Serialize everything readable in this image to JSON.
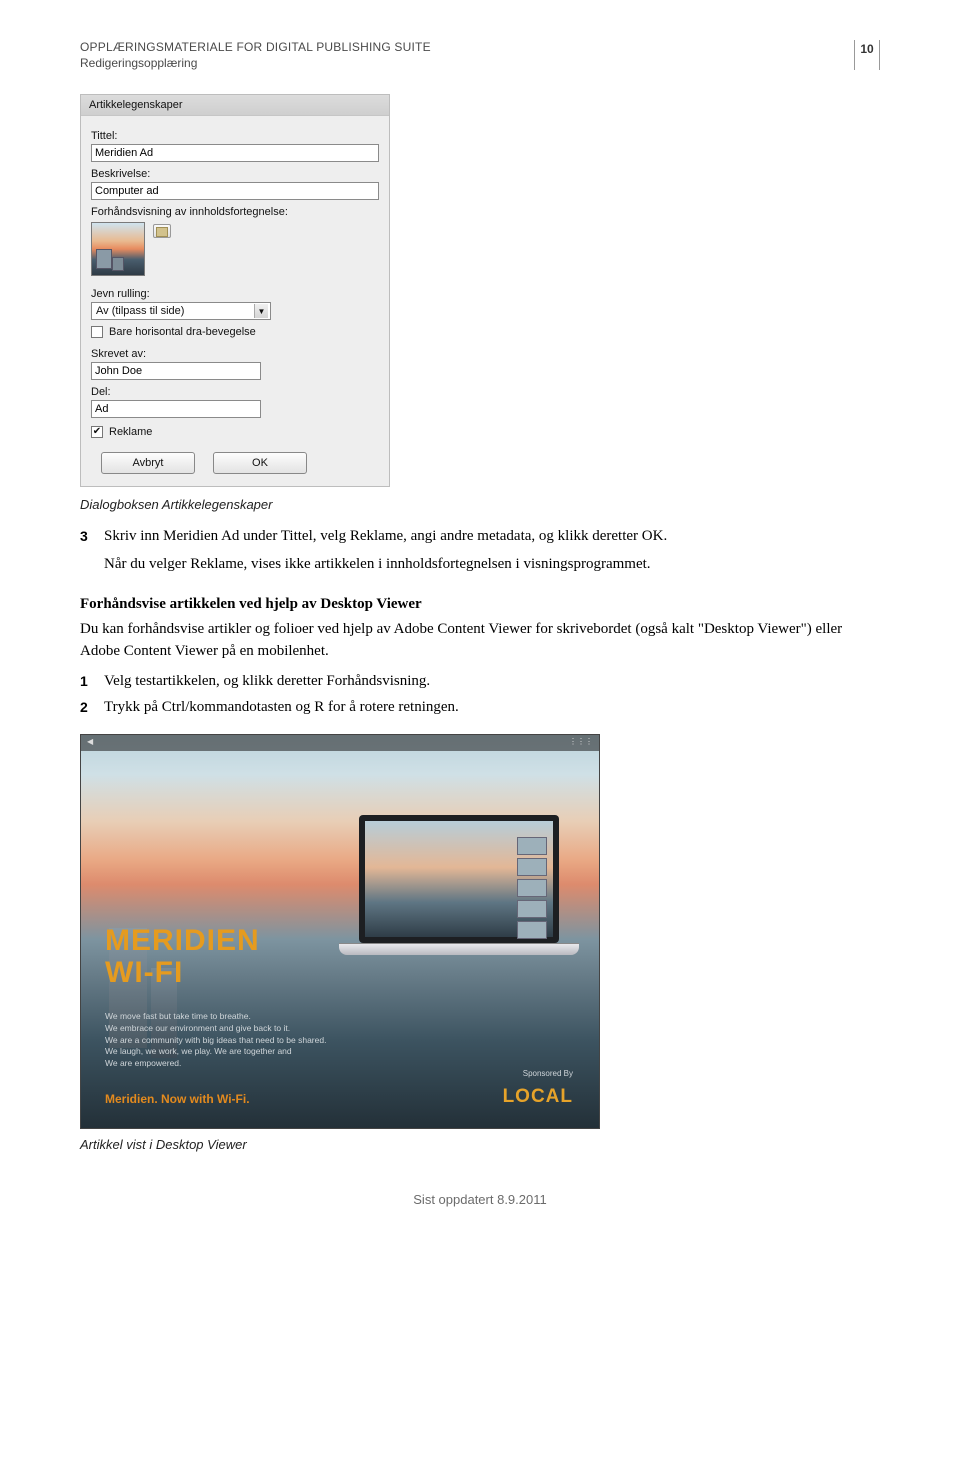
{
  "header": {
    "line1": "OPPLÆRINGSMATERIALE FOR DIGITAL PUBLISHING SUITE",
    "line2": "Redigeringsopplæring",
    "page_number": "10"
  },
  "dialog": {
    "title": "Artikkelegenskaper",
    "title_label": "Tittel:",
    "title_value": "Meridien Ad",
    "desc_label": "Beskrivelse:",
    "desc_value": "Computer ad",
    "preview_label": "Forhåndsvisning av innholdsfortegnelse:",
    "scroll_label": "Jevn rulling:",
    "scroll_value": "Av (tilpass til side)",
    "horiz_only_label": "Bare horisontal dra-bevegelse",
    "author_label": "Skrevet av:",
    "author_value": "John Doe",
    "section_label": "Del:",
    "section_value": "Ad",
    "ad_checkbox_label": "Reklame",
    "cancel_label": "Avbryt",
    "ok_label": "OK"
  },
  "caption1": "Dialogboksen Artikkelegenskaper",
  "step3_num": "3",
  "step3_text": "Skriv inn Meridien Ad under Tittel, velg Reklame, angi andre metadata, og klikk deretter OK.",
  "step3_followup": "Når du velger Reklame, vises ikke artikkelen i innholdsfortegnelsen i visningsprogrammet.",
  "section_heading": "Forhåndsvise artikkelen ved hjelp av Desktop Viewer",
  "section_body": "Du kan forhåndsvise artikler og folioer ved hjelp av Adobe Content Viewer for skrivebordet (også kalt \"Desktop Viewer\") eller Adobe Content Viewer på en mobilenhet.",
  "step1_num": "1",
  "step1_text": "Velg testartikkelen, og klikk deretter Forhåndsvisning.",
  "step2_num": "2",
  "step2_text": "Trykk på Ctrl/kommandotasten og R for å rotere retningen.",
  "ad": {
    "headline1": "MERIDIEN",
    "headline2": "WI-FI",
    "tag1": "We move fast but take time to breathe.",
    "tag2": "We embrace our environment and give back to it.",
    "tag3": "We are a community with big ideas that need to be shared.",
    "tag4": "We laugh, we work, we play. We are together and",
    "tag5": "We are empowered.",
    "cta": "Meridien. Now with Wi-Fi.",
    "sponsor_label": "Sponsored By",
    "sponsor_logo": "LOCAL"
  },
  "caption2": "Artikkel vist i Desktop Viewer",
  "footer": "Sist oppdatert 8.9.2011"
}
